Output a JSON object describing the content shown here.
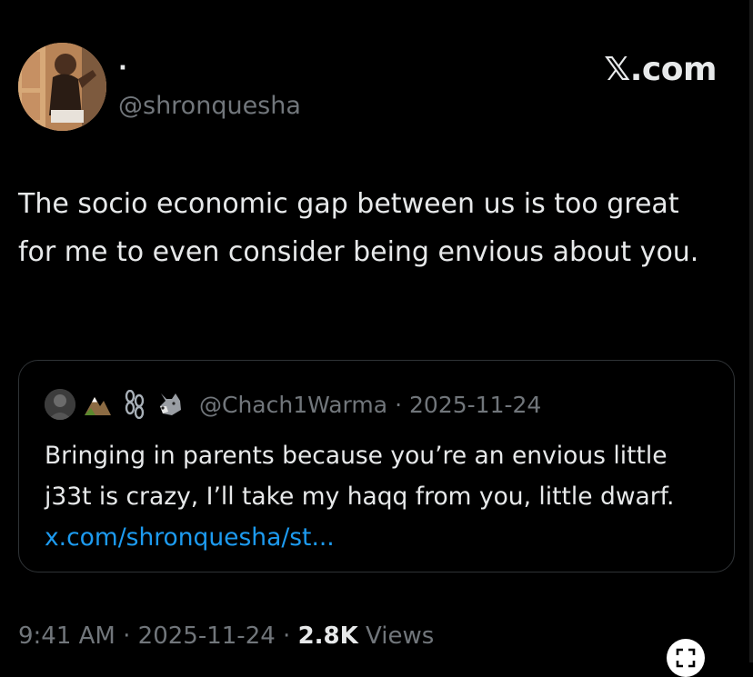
{
  "header": {
    "display_name": "·",
    "handle": "@shronquesha",
    "watermark": "𝕏.com"
  },
  "tweet": {
    "text": "The socio economic gap between us is too great for me to even consider being envious about you."
  },
  "quote": {
    "emoji_icons": [
      "mountain-emoji-icon",
      "chains-emoji-icon",
      "wolf-emoji-icon"
    ],
    "handle": "@Chach1Warma",
    "separator": "·",
    "date": "2025-11-24",
    "text": "Bringing in parents because you’re an envious little j33t is crazy, I’ll take my haqq from you, little dwarf. ",
    "link": "x.com/shronquesha/st..."
  },
  "meta": {
    "time": "9:41 AM",
    "sep1": " · ",
    "date": "2025-11-24",
    "sep2": " · ",
    "views_count": "2.8K",
    "views_label": " Views"
  },
  "colors": {
    "background": "#000000",
    "text_primary": "#e7e9ea",
    "text_secondary": "#71767b",
    "link": "#1d9bf0",
    "border": "#2f3336"
  }
}
